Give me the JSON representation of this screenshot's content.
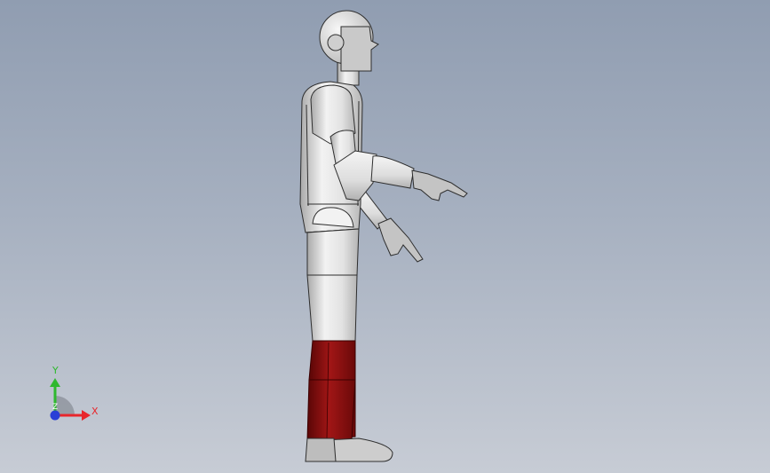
{
  "viewport": {
    "background_top": "#909db1",
    "background_bottom": "#c7ccd5"
  },
  "model": {
    "body_color": "#dcdcdc",
    "shade_color": "#b9b9b9",
    "edge_color": "#2e2e2e",
    "hand_color": "#c4c4c4",
    "shin_color": "#8b1010",
    "shin_dark": "#5e0808",
    "foot_color": "#cdcdcd"
  },
  "triad": {
    "x_label": "X",
    "y_label": "Y",
    "z_label": "Z",
    "x_color": "#e8262b",
    "y_color": "#2eb82e",
    "z_color": "#2a3fd6"
  }
}
